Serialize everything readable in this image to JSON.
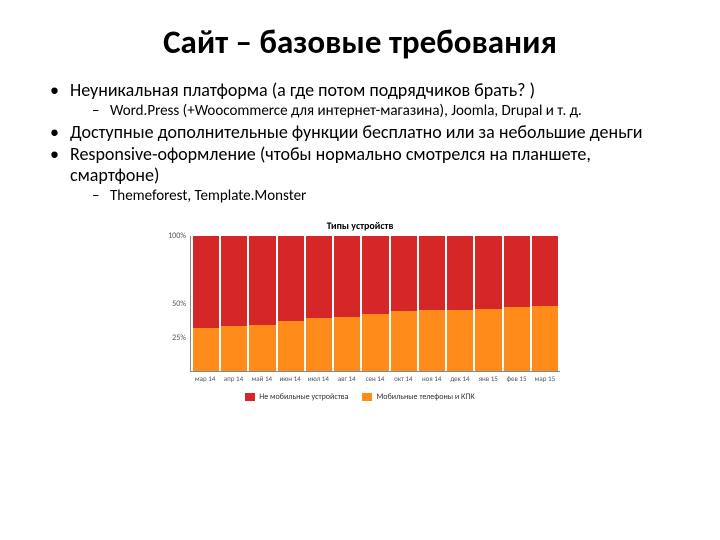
{
  "title": "Сайт – базовые требования",
  "bullets": {
    "b1": "Неуникальная платформа (а где потом подрядчиков брать? )",
    "b1a": "Word.Press (+Woocommerce для интернет-магазина), Joomla, Drupal и т. д.",
    "b2": "Доступные дополнительные функции бесплатно или за небольшие деньги",
    "b3": "Responsive-оформление (чтобы нормально смотрелся на планшете, смартфоне)",
    "b3a": "Themeforest, Template.Monster"
  },
  "chart_data": {
    "type": "bar",
    "title": "Типы устройств",
    "ylabel": "",
    "xlabel": "",
    "ylim": [
      0,
      100
    ],
    "yticks": [
      100,
      50,
      25
    ],
    "categories": [
      "мар 14",
      "апр 14",
      "май 14",
      "июн 14",
      "июл 14",
      "авг 14",
      "сен 14",
      "окт 14",
      "ноя 14",
      "дек 14",
      "янв 15",
      "фев 15",
      "мар 15"
    ],
    "series": [
      {
        "name": "Не мобильные устройства",
        "color": "#d62728",
        "values": [
          68,
          67,
          66,
          63,
          61,
          60,
          58,
          56,
          55,
          55,
          54,
          53,
          52
        ]
      },
      {
        "name": "Мобильные телефоны и КПК",
        "color": "#ff8c1a",
        "values": [
          32,
          33,
          34,
          37,
          39,
          40,
          42,
          44,
          45,
          45,
          46,
          47,
          48
        ]
      }
    ]
  }
}
